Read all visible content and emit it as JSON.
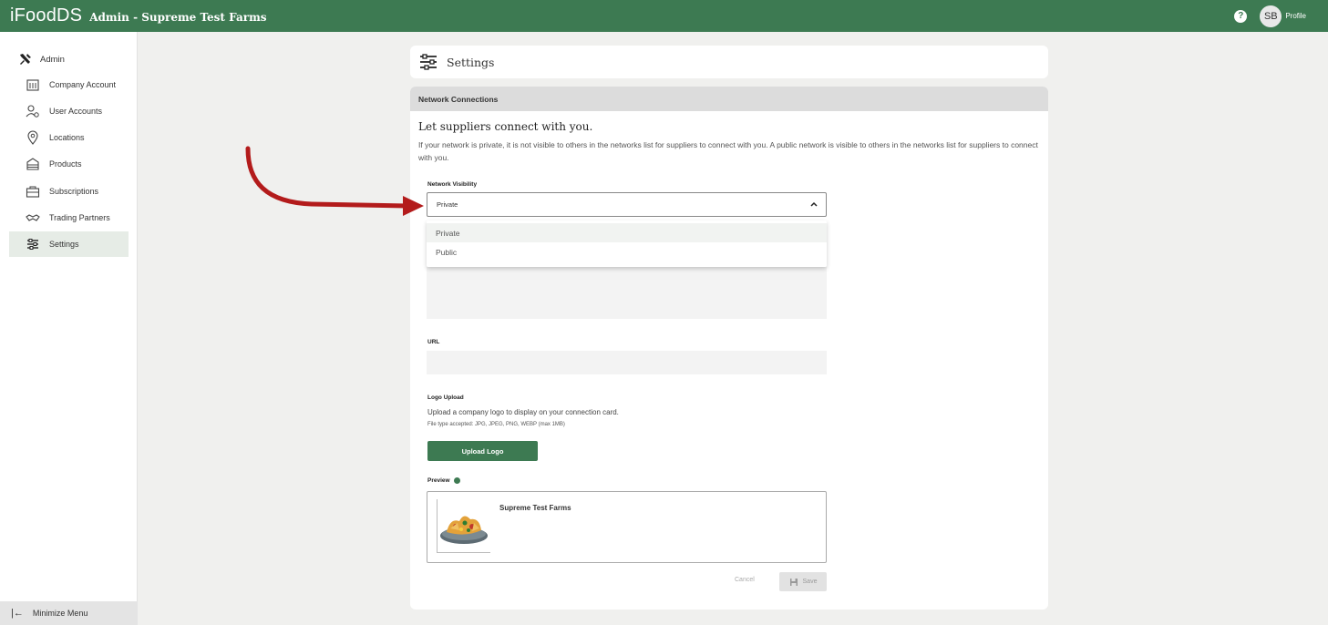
{
  "topbar": {
    "brand": "iFoodDS",
    "subtitle": "Admin - Supreme Test Farms",
    "help_glyph": "?",
    "avatar_initials": "SB",
    "profile_label": "Profile"
  },
  "sidebar": {
    "admin_label": "Admin",
    "items": [
      {
        "label": "Company Account",
        "icon": "building-icon"
      },
      {
        "label": "User Accounts",
        "icon": "user-settings-icon"
      },
      {
        "label": "Locations",
        "icon": "location-pin-icon"
      },
      {
        "label": "Products",
        "icon": "products-icon"
      },
      {
        "label": "Subscriptions",
        "icon": "subscriptions-icon"
      },
      {
        "label": "Trading Partners",
        "icon": "handshake-icon"
      },
      {
        "label": "Settings",
        "icon": "sliders-icon",
        "active": true
      }
    ],
    "minimize_label": "Minimize Menu"
  },
  "header": {
    "title": "Settings"
  },
  "section": {
    "title": "Network Connections",
    "intro_title": "Let suppliers connect with you.",
    "intro_text": "If your network is private, it is not visible to others in the networks list for suppliers to connect with you. A public network is visible to others in the networks list for suppliers to connect with you."
  },
  "form": {
    "visibility_label": "Network Visibility",
    "visibility_value": "Private",
    "visibility_options": [
      "Private",
      "Public"
    ],
    "url_label": "URL",
    "logo_label": "Logo Upload",
    "logo_description": "Upload a company logo to display on your connection card.",
    "logo_note": "File type accepted: JPG, JPEG, PNG, WEBP (max 1MB)",
    "upload_button": "Upload Logo",
    "preview_label": "Preview",
    "preview_company": "Supreme Test Farms",
    "cancel_button": "Cancel",
    "save_button": "Save"
  },
  "colors": {
    "brand_green": "#3d7a52",
    "annotation_arrow": "#b31b1b"
  }
}
